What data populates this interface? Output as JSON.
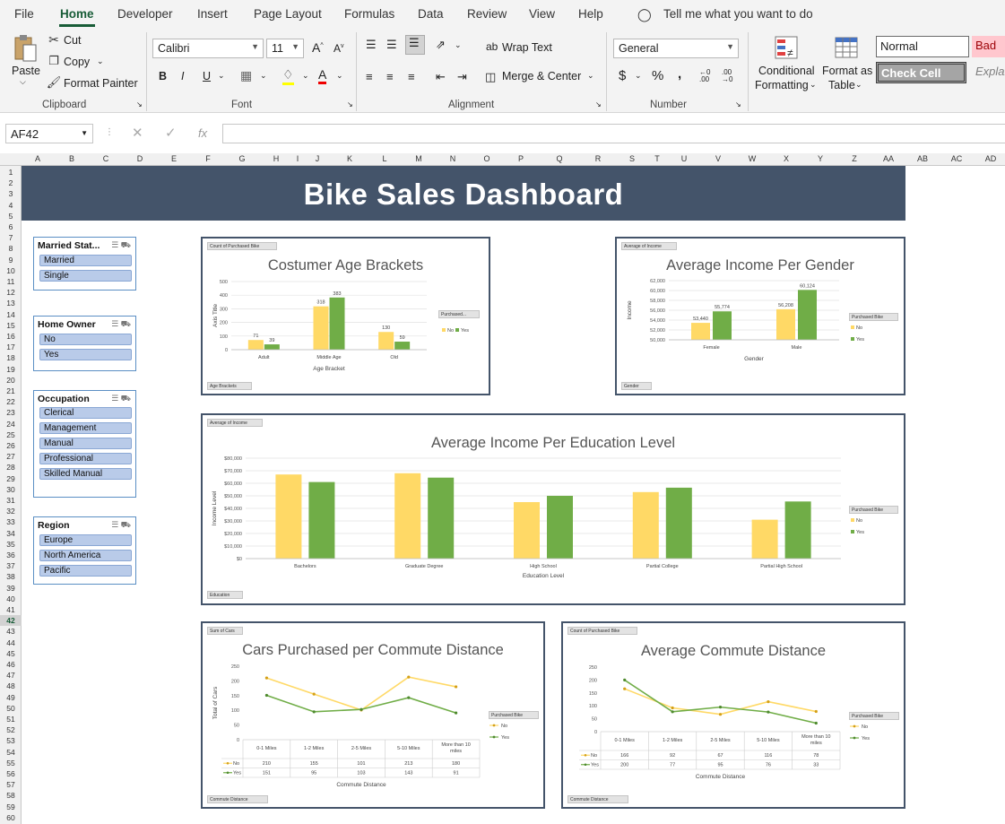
{
  "ribbon_tabs": [
    "File",
    "Home",
    "Developer",
    "Insert",
    "Page Layout",
    "Formulas",
    "Data",
    "Review",
    "View",
    "Help"
  ],
  "tell_me": "Tell me what you want to do",
  "clipboard": {
    "paste": "Paste",
    "cut": "Cut",
    "copy": "Copy",
    "format_painter": "Format Painter",
    "label": "Clipboard"
  },
  "font": {
    "name": "Calibri",
    "size": "11",
    "bold": "B",
    "italic": "I",
    "underline": "U",
    "label": "Font"
  },
  "alignment": {
    "wrap": "Wrap Text",
    "merge": "Merge & Center",
    "label": "Alignment"
  },
  "number": {
    "format": "General",
    "currency": "$",
    "percent": "%",
    "comma": ",",
    "label": "Number"
  },
  "styles": {
    "conditional_1": "Conditional",
    "conditional_2": "Formatting",
    "format_table_1": "Format as",
    "format_table_2": "Table",
    "normal": "Normal",
    "bad": "Bad",
    "check_cell": "Check Cell",
    "explanatory": "Explan"
  },
  "name_box": "AF42",
  "fx": "fx",
  "columns": [
    "A",
    "B",
    "C",
    "D",
    "E",
    "F",
    "G",
    "H",
    "I",
    "J",
    "K",
    "L",
    "M",
    "N",
    "O",
    "P",
    "Q",
    "R",
    "S",
    "T",
    "U",
    "V",
    "W",
    "X",
    "Y",
    "Z",
    "AA",
    "AB",
    "AC",
    "AD"
  ],
  "dashboard_title": "Bike Sales Dashboard",
  "slicers": [
    {
      "title": "Married Stat...",
      "items": [
        "Married",
        "Single"
      ]
    },
    {
      "title": "Home Owner",
      "items": [
        "No",
        "Yes"
      ]
    },
    {
      "title": "Occupation",
      "items": [
        "Clerical",
        "Management",
        "Manual",
        "Professional",
        "Skilled Manual"
      ]
    },
    {
      "title": "Region",
      "items": [
        "Europe",
        "North America",
        "Pacific"
      ]
    }
  ],
  "colors": {
    "no": "#ffd966",
    "yes": "#70ad47",
    "no_line": "#ffd966",
    "no_marker": "#d4a017",
    "banner": "#44546a"
  },
  "chart_data": [
    {
      "type": "bar",
      "title": "Costumer Age Brackets",
      "field_button": "Count of Purchased Bike",
      "axis_button": "Age Brackets",
      "legend_button": "Purchased...",
      "xlabel": "Age Bracket",
      "ylabel": "Axis Title",
      "categories": [
        "Adult",
        "Middle Age",
        "Old"
      ],
      "series": [
        {
          "name": "No",
          "values": [
            71,
            318,
            130
          ]
        },
        {
          "name": "Yes",
          "values": [
            39,
            383,
            59
          ]
        }
      ],
      "ylim": [
        0,
        500
      ],
      "yticks": [
        "0",
        "100",
        "200",
        "300",
        "400",
        "500"
      ]
    },
    {
      "type": "bar",
      "title": "Average Income Per Gender",
      "field_button": "Average of Income",
      "axis_button": "Gender",
      "legend_button": "Purchased Bike",
      "xlabel": "Gender",
      "ylabel": "Income",
      "categories": [
        "Female",
        "Male"
      ],
      "series": [
        {
          "name": "No",
          "values": [
            53440,
            56208
          ],
          "labels": [
            "53,440",
            "56,208"
          ]
        },
        {
          "name": "Yes",
          "values": [
            55774,
            60124
          ],
          "labels": [
            "55,774",
            "60,124"
          ]
        }
      ],
      "ylim": [
        50000,
        62000
      ],
      "yticks": [
        "50,000",
        "52,000",
        "54,000",
        "56,000",
        "58,000",
        "60,000",
        "62,000"
      ]
    },
    {
      "type": "bar",
      "title": "Average Income Per Education Level",
      "field_button": "Average of Income",
      "axis_button": "Education",
      "legend_button": "Purchased Bike",
      "xlabel": "Education Level",
      "ylabel": "Income Level",
      "categories": [
        "Bachelors",
        "Graduate Degree",
        "High School",
        "Partial College",
        "Partial High School"
      ],
      "series": [
        {
          "name": "No",
          "values": [
            67000,
            68000,
            45000,
            53000,
            31000
          ]
        },
        {
          "name": "Yes",
          "values": [
            61000,
            64500,
            50000,
            56500,
            45500
          ]
        }
      ],
      "ylim": [
        0,
        80000
      ],
      "yticks": [
        "$0",
        "$10,000",
        "$20,000",
        "$30,000",
        "$40,000",
        "$50,000",
        "$60,000",
        "$70,000",
        "$80,000"
      ]
    },
    {
      "type": "line",
      "title": "Cars Purchased per Commute Distance",
      "field_button": "Sum of Cars",
      "axis_button": "Commute Distance",
      "legend_button": "Purchased Bike",
      "xlabel": "Commute Distance",
      "ylabel": "Total of Cars",
      "categories": [
        "0-1 Miles",
        "1-2 Miles",
        "2-5 Miles",
        "5-10 Miles",
        "More than 10 miles"
      ],
      "series": [
        {
          "name": "No",
          "values": [
            210,
            155,
            101,
            213,
            180
          ]
        },
        {
          "name": "Yes",
          "values": [
            151,
            95,
            103,
            143,
            91
          ]
        }
      ],
      "ylim": [
        0,
        250
      ],
      "yticks": [
        "0",
        "50",
        "100",
        "150",
        "200",
        "250"
      ]
    },
    {
      "type": "line",
      "title": "Average Commute Distance",
      "field_button": "Count of Purchased Bike",
      "axis_button": "Commute Distance",
      "legend_button": "Purchased Bike",
      "xlabel": "Commute Distance",
      "ylabel": "",
      "categories": [
        "0-1 Miles",
        "1-2 Miles",
        "2-5 Miles",
        "5-10 Miles",
        "More than 10 miles"
      ],
      "series": [
        {
          "name": "No",
          "values": [
            166,
            92,
            67,
            116,
            78
          ]
        },
        {
          "name": "Yes",
          "values": [
            200,
            77,
            95,
            76,
            33
          ]
        }
      ],
      "ylim": [
        0,
        250
      ],
      "yticks": [
        "0",
        "50",
        "100",
        "150",
        "200",
        "250"
      ]
    }
  ]
}
